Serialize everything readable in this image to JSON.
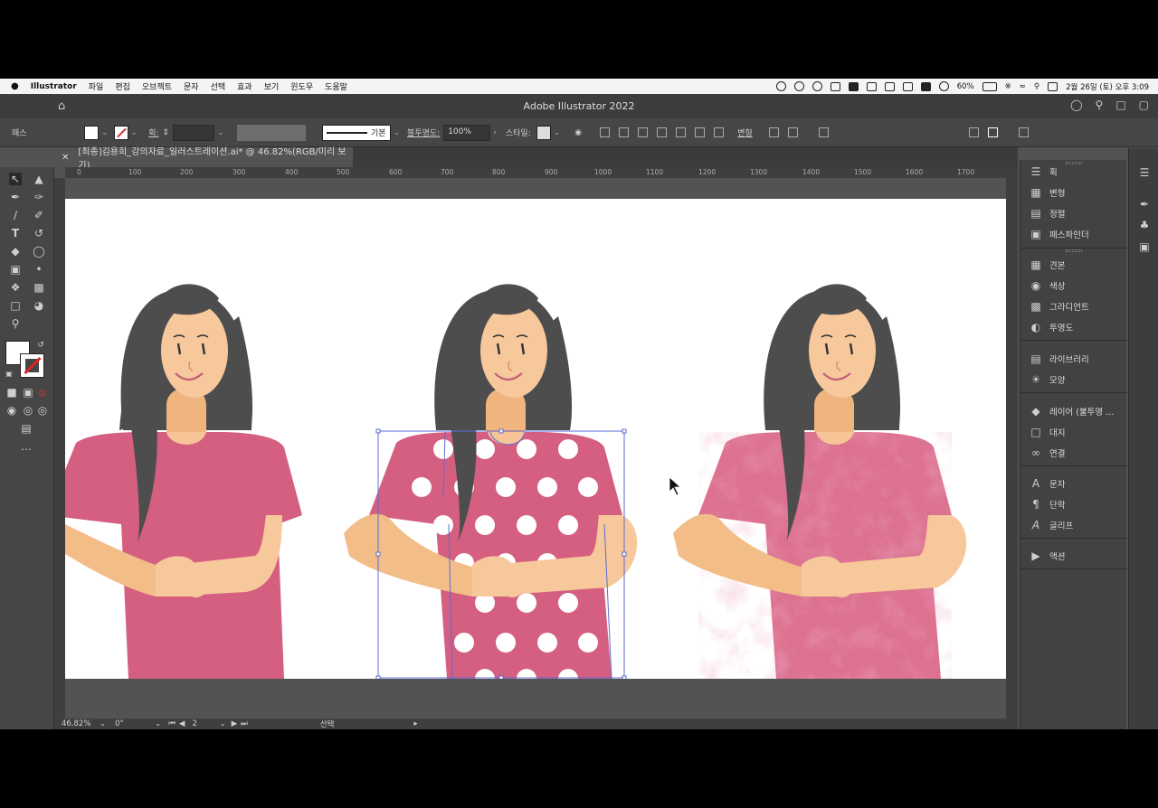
{
  "menubar": {
    "apple": "",
    "app": "Illustrator",
    "items": [
      "파일",
      "편집",
      "오브젝트",
      "문자",
      "선택",
      "효과",
      "보기",
      "윈도우",
      "도움말"
    ],
    "battery": "60%",
    "datetime": "2월 26일 (토) 오후 3:09"
  },
  "window": {
    "title": "Adobe Illustrator 2022"
  },
  "control": {
    "selection_label": "패스",
    "stroke_label": "획:",
    "stroke_style": "기본",
    "opacity_label": "불투명도:",
    "opacity_value": "100%",
    "style_label": "스타일:",
    "transform_label": "변형"
  },
  "document": {
    "tab_title": "[최종]김용희_강의자료_일러스트레이션.ai* @ 46.82%(RGB/미리 보기)"
  },
  "ruler": {
    "ticks": [
      "0",
      "100",
      "200",
      "300",
      "400",
      "500",
      "600",
      "700",
      "800",
      "900",
      "1000",
      "1100",
      "1200",
      "1300",
      "1400",
      "1500",
      "1600",
      "1700"
    ]
  },
  "status": {
    "zoom": "46.82%",
    "rotation": "0°",
    "artboard": "2",
    "tool": "선택"
  },
  "panels": [
    {
      "label": "획",
      "icon": "stroke-icon"
    },
    {
      "label": "변형",
      "icon": "transform-icon"
    },
    {
      "label": "정렬",
      "icon": "align-icon"
    },
    {
      "label": "패스파인더",
      "icon": "pathfinder-icon"
    },
    {
      "label": "견본",
      "icon": "swatches-icon"
    },
    {
      "label": "색상",
      "icon": "color-icon"
    },
    {
      "label": "그라디언트",
      "icon": "gradient-icon"
    },
    {
      "label": "투명도",
      "icon": "transparency-icon"
    },
    {
      "label": "라이브러리",
      "icon": "libraries-icon"
    },
    {
      "label": "모양",
      "icon": "appearance-icon"
    },
    {
      "label": "레이어 (불투명 ...",
      "icon": "layers-icon"
    },
    {
      "label": "대지",
      "icon": "artboards-icon"
    },
    {
      "label": "연결",
      "icon": "links-icon"
    },
    {
      "label": "문자",
      "icon": "character-icon"
    },
    {
      "label": "단락",
      "icon": "paragraph-icon"
    },
    {
      "label": "글리프",
      "icon": "glyphs-icon"
    },
    {
      "label": "액션",
      "icon": "actions-icon"
    }
  ],
  "colors": {
    "shirt_plain": "#d45f80",
    "shirt_textured": "#dc7290",
    "hair": "#4d4d4d",
    "skin": "#f7c89b",
    "arm": "#f3bd88",
    "selection": "#5d6bd1"
  }
}
